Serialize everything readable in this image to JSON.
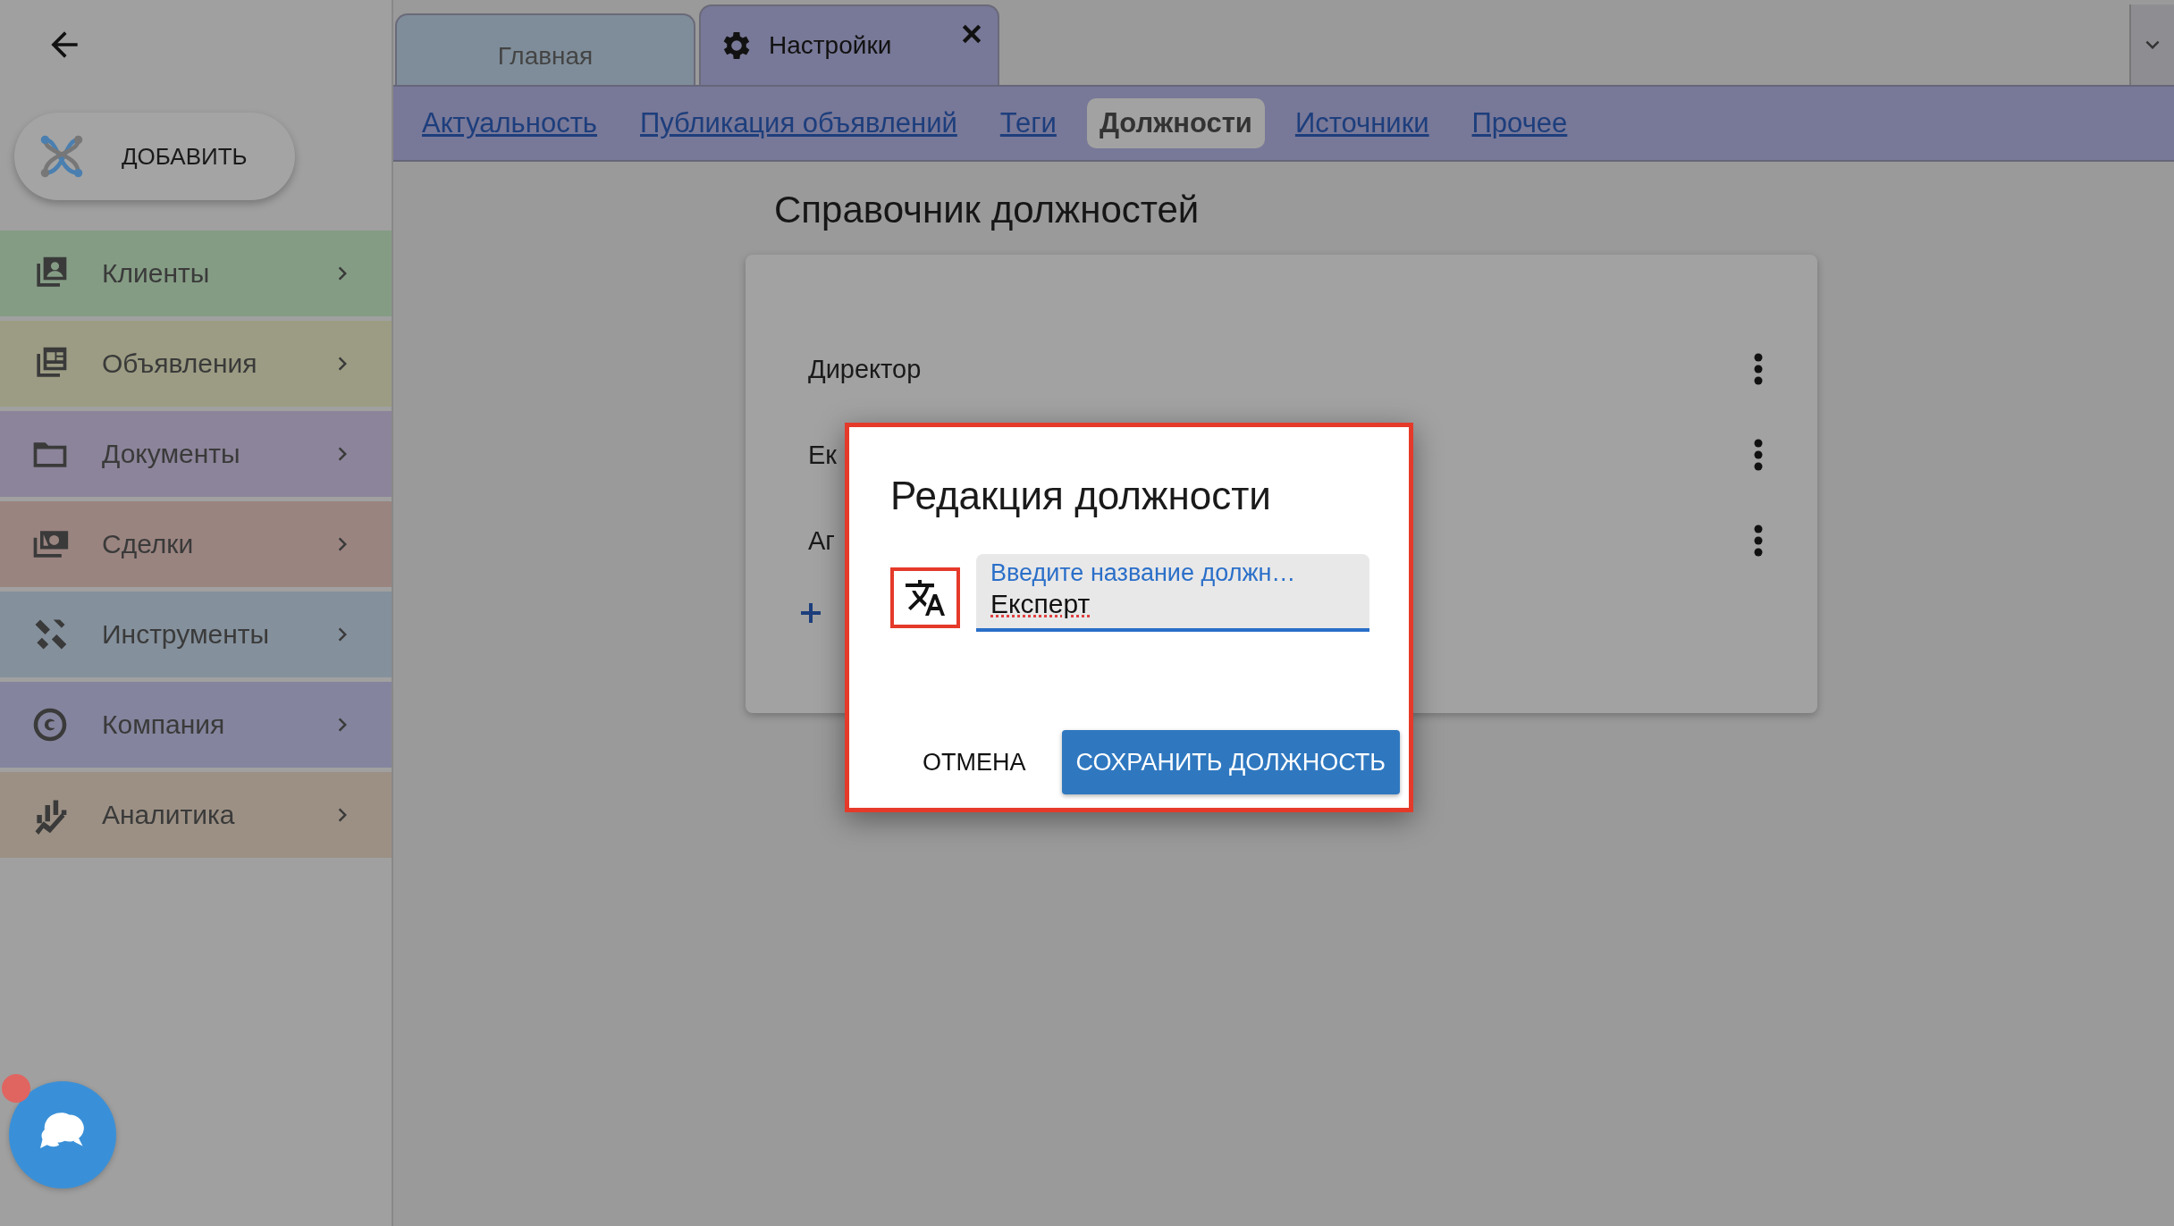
{
  "sidebar": {
    "add_button": "ДОБАВИТЬ",
    "items": [
      {
        "label": "Клиенты",
        "color": "#849c84"
      },
      {
        "label": "Объявления",
        "color": "#9c9c84"
      },
      {
        "label": "Документы",
        "color": "#8c849a"
      },
      {
        "label": "Сделки",
        "color": "#9a8480"
      },
      {
        "label": "Инструменты",
        "color": "#84909c"
      },
      {
        "label": "Компания",
        "color": "#84849e"
      },
      {
        "label": "Аналитика",
        "color": "#9c9084"
      }
    ]
  },
  "tabs": [
    {
      "label": "Главная",
      "selected": false,
      "has_icon": false,
      "closable": false
    },
    {
      "label": "Настройки",
      "selected": true,
      "has_icon": true,
      "closable": true
    }
  ],
  "sub_tabs": [
    {
      "label": "Актуальность",
      "selected": false
    },
    {
      "label": "Публикация объявлений",
      "selected": false
    },
    {
      "label": "Теги",
      "selected": false
    },
    {
      "label": "Должности",
      "selected": true
    },
    {
      "label": "Источники",
      "selected": false
    },
    {
      "label": "Прочее",
      "selected": false
    }
  ],
  "page": {
    "title": "Справочник должностей",
    "positions": [
      {
        "name": "Директор"
      },
      {
        "name": "Ек"
      },
      {
        "name": "Аг"
      }
    ]
  },
  "dialog": {
    "title": "Редакция должности",
    "field": {
      "label": "Введите название должн…",
      "value": "Експерт"
    },
    "cancel": "ОТМЕНА",
    "save": "СОХРАНИТЬ ДОЛЖНОСТЬ"
  },
  "chat": {
    "unread": true
  }
}
